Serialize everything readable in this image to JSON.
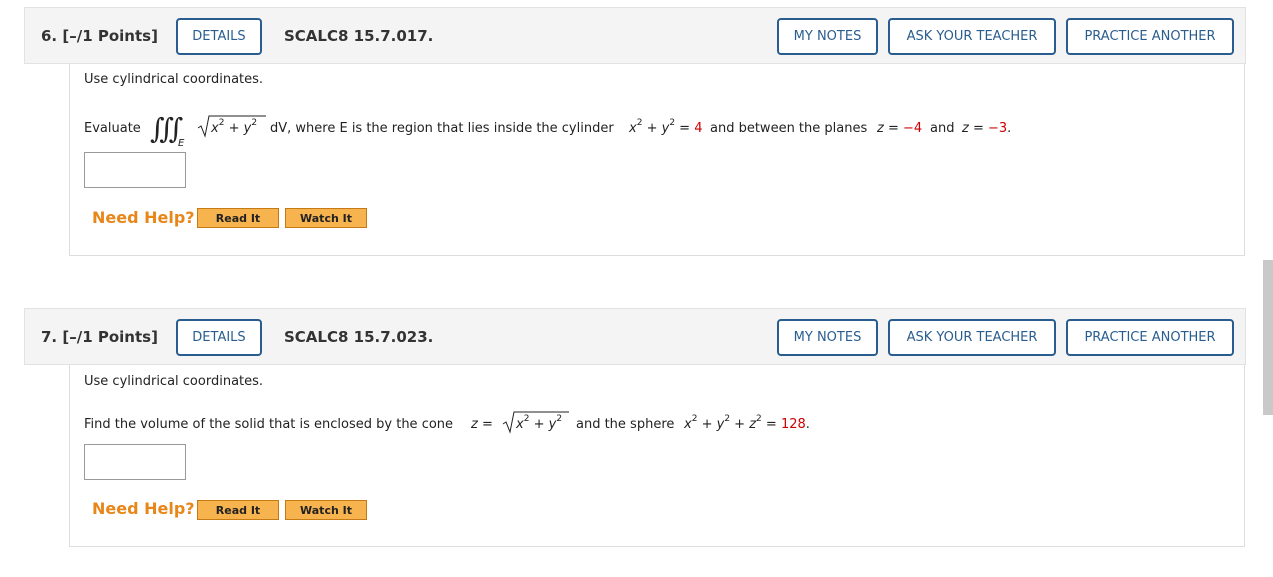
{
  "buttons": {
    "details": "DETAILS",
    "my_notes": "MY NOTES",
    "ask_teacher": "ASK YOUR TEACHER",
    "practice_another": "PRACTICE ANOTHER",
    "read_it": "Read It",
    "watch_it": "Watch It"
  },
  "need_help": "Need Help?",
  "q6": {
    "number": "6.  [–/1 Points]",
    "code": "SCALC8 15.7.017.",
    "instruction": "Use cylindrical coordinates.",
    "evaluate": "Evaluate",
    "text_dv": "dV,  where E is the region that lies inside the cylinder",
    "cyl_value": "4",
    "text_planes": "and between the planes",
    "z1": "−4",
    "and": "and",
    "z2": "−3",
    "answer": ""
  },
  "q7": {
    "number": "7.  [–/1 Points]",
    "code": "SCALC8 15.7.023.",
    "instruction": "Use cylindrical coordinates.",
    "text_find": "Find the volume of the solid that is enclosed by the cone",
    "text_sphere": "and the sphere",
    "sphere_value": "128",
    "answer": ""
  }
}
